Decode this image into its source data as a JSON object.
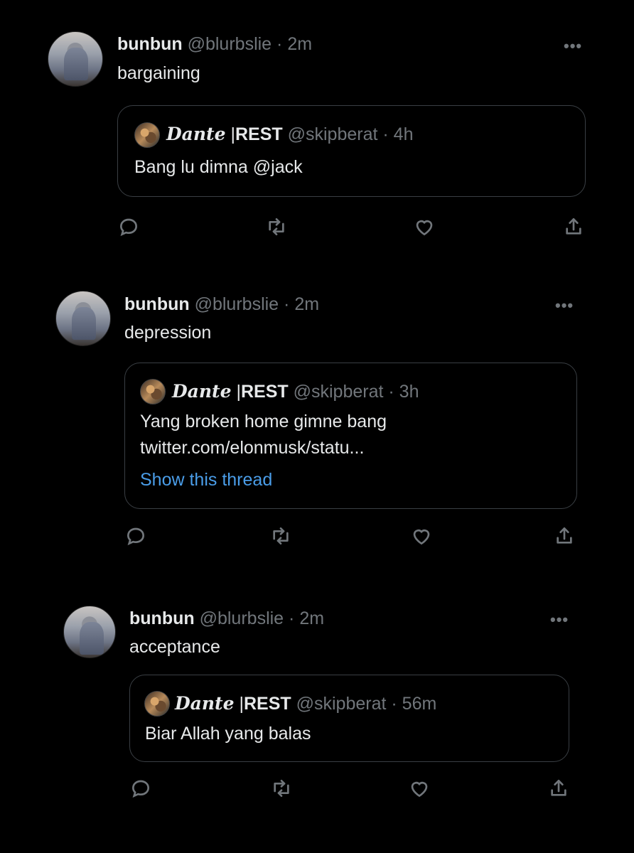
{
  "tweets": [
    {
      "name": "bunbun",
      "handle": "@blurbslie",
      "dot": "·",
      "time": "2m",
      "text": "bargaining",
      "more": "•••",
      "quote": {
        "name_italic": "Dante",
        "sep": "|",
        "name_rest": "REST",
        "handle": "@skipberat",
        "dot": "·",
        "time": "4h",
        "lines": [
          "Bang lu dimna @jack"
        ],
        "link": ""
      }
    },
    {
      "name": "bunbun",
      "handle": "@blurbslie",
      "dot": "·",
      "time": "2m",
      "text": "depression",
      "more": "•••",
      "quote": {
        "name_italic": "Dante",
        "sep": "|",
        "name_rest": "REST",
        "handle": "@skipberat",
        "dot": "·",
        "time": "3h",
        "lines": [
          "Yang broken home gimne bang",
          "twitter.com/elonmusk/statu..."
        ],
        "link": "Show this thread"
      }
    },
    {
      "name": "bunbun",
      "handle": "@blurbslie",
      "dot": "·",
      "time": "2m",
      "text": "acceptance",
      "more": "•••",
      "quote": {
        "name_italic": "Dante",
        "sep": "|",
        "name_rest": "REST",
        "handle": "@skipberat",
        "dot": "·",
        "time": "56m",
        "lines": [
          "Biar Allah yang balas"
        ],
        "link": ""
      }
    }
  ],
  "icons": {
    "reply": "reply-icon",
    "retweet": "retweet-icon",
    "like": "heart-icon",
    "share": "share-icon",
    "more": "more-icon"
  },
  "colors": {
    "background": "#000000",
    "text": "#e7e9ea",
    "muted": "#71767b",
    "link": "#4a9de8",
    "border": "#3a3f44"
  }
}
